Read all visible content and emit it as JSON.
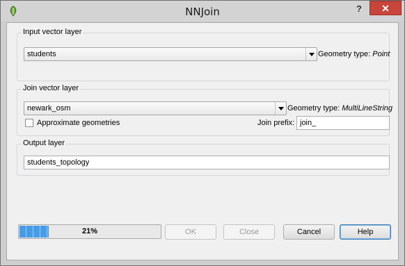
{
  "window": {
    "title": "NNJoin",
    "help_label": "?",
    "close_label": "✕"
  },
  "input_layer": {
    "group_title": "Input vector layer",
    "selected": "students",
    "geometry_label": "Geometry type: ",
    "geometry_value": "Point"
  },
  "join_layer": {
    "group_title": "Join vector layer",
    "selected": "newark_osm",
    "geometry_label": "Geometry type: ",
    "geometry_value": "MultiLineString",
    "approximate_label": "Approximate geometries",
    "approximate_checked": false,
    "join_prefix_label": "Join prefix:",
    "join_prefix_value": "join_"
  },
  "output": {
    "group_title": "Output layer",
    "value": "students_topology"
  },
  "progress": {
    "percent": 21,
    "label": "21%"
  },
  "buttons": {
    "ok": "OK",
    "close": "Close",
    "cancel": "Cancel",
    "help": "Help"
  },
  "colors": {
    "progress_fill": "#4a9be6",
    "close_button": "#c7453a"
  }
}
